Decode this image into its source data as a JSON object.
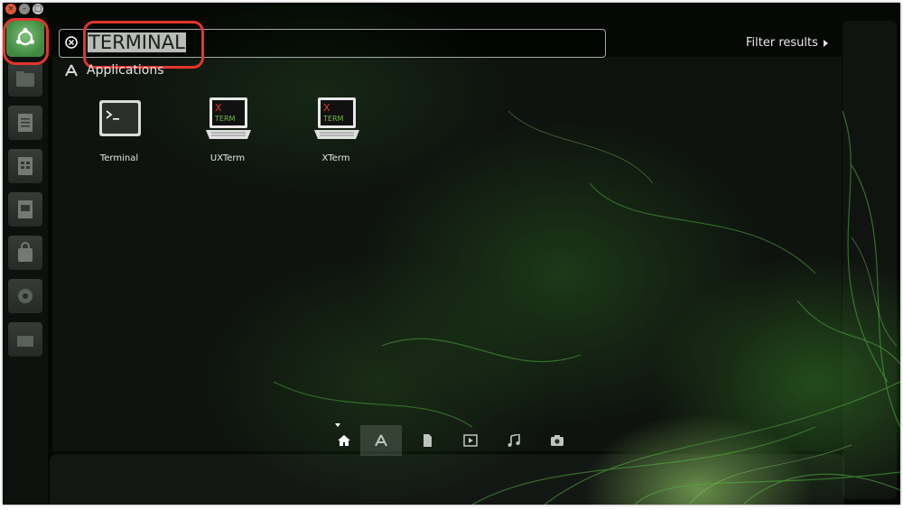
{
  "window": {
    "close_glyph": "×",
    "minimize_glyph": "–",
    "maximize_glyph": "▢"
  },
  "launcher": {
    "items": [
      {
        "icon": "ubuntu-logo-icon",
        "role": "dash-home"
      },
      {
        "icon": "files-icon"
      },
      {
        "icon": "writer-document-icon"
      },
      {
        "icon": "calc-spreadsheet-icon"
      },
      {
        "icon": "impress-presentation-icon"
      },
      {
        "icon": "software-center-bag-icon"
      },
      {
        "icon": "system-settings-gear-icon"
      },
      {
        "icon": "trash-icon"
      }
    ]
  },
  "search": {
    "value": "TERMINAL",
    "clear_icon": "clear-circle-icon"
  },
  "filter": {
    "label": "Filter results"
  },
  "results": {
    "section_title": "Applications",
    "apps": [
      {
        "label": "Terminal",
        "icon": "terminal-app-icon"
      },
      {
        "label": "UXTerm",
        "icon": "xterm-app-icon",
        "badge_top": "X",
        "badge_bottom": "TERM"
      },
      {
        "label": "XTerm",
        "icon": "xterm-app-icon",
        "badge_top": "X",
        "badge_bottom": "TERM"
      }
    ]
  },
  "lenses": {
    "active": "applications",
    "items": [
      "home-lens-icon",
      "applications-lens-icon",
      "files-lens-icon",
      "video-lens-icon",
      "music-lens-icon",
      "photos-lens-icon"
    ]
  },
  "colors": {
    "highlight": "#e3362c",
    "accent_green": "#3f8a3f",
    "xterm_x": "#e83b2a",
    "xterm_term": "#6fbf4a"
  }
}
